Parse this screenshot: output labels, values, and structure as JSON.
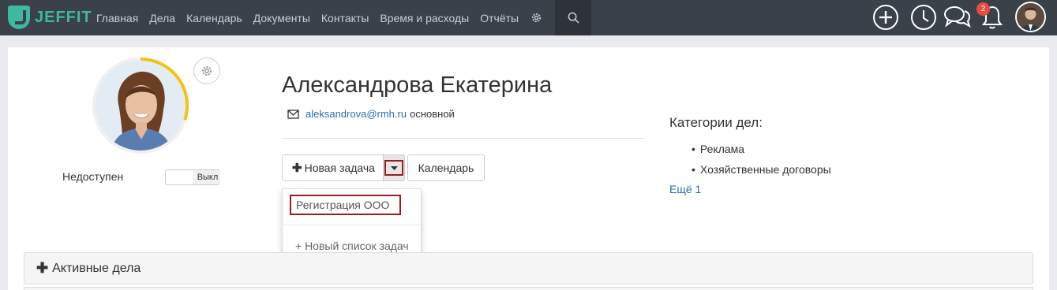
{
  "app": {
    "logo_text": "JEFFIT",
    "brand_color": "#3fb8a0",
    "accent_color": "#2a6fa8",
    "highlight_color": "#9b1c1c"
  },
  "nav": {
    "items": [
      {
        "label": "Главная"
      },
      {
        "label": "Дела"
      },
      {
        "label": "Календарь"
      },
      {
        "label": "Документы"
      },
      {
        "label": "Контакты"
      },
      {
        "label": "Время и расходы"
      },
      {
        "label": "Отчёты"
      }
    ],
    "settings_icon": "gear-icon",
    "search_icon": "search-icon",
    "right_icons": [
      "plus-circle-icon",
      "clock-icon",
      "chat-icon",
      "bell-icon"
    ],
    "notifications_count": "2"
  },
  "profile": {
    "name": "Александрова Екатерина",
    "email": "aleksandrova@rmh.ru",
    "email_tag": "основной",
    "status_label": "Недоступен",
    "toggle_label": "Выкл",
    "progress_ring_fraction": 0.3
  },
  "actions": {
    "new_task_label": "Новая задача",
    "calendar_label": "Календарь",
    "dropdown_items": [
      "Регистрация ООО",
      "+ Новый список задач"
    ]
  },
  "categories": {
    "title": "Категории дел:",
    "items": [
      "Реклама",
      "Хозяйственные договоры"
    ],
    "more_label": "Ещё 1"
  },
  "sections": {
    "active_label": "Активные дела"
  }
}
